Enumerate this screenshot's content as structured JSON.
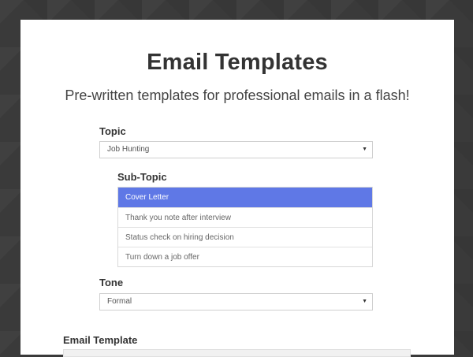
{
  "header": {
    "title": "Email Templates",
    "subtitle": "Pre-written templates for professional emails in a flash!"
  },
  "topic": {
    "label": "Topic",
    "selected": "Job Hunting"
  },
  "subtopic": {
    "label": "Sub-Topic",
    "options": [
      {
        "label": "Cover Letter",
        "selected": true
      },
      {
        "label": "Thank you note after interview",
        "selected": false
      },
      {
        "label": "Status check on hiring decision",
        "selected": false
      },
      {
        "label": "Turn down a job offer",
        "selected": false
      }
    ]
  },
  "tone": {
    "label": "Tone",
    "selected": "Formal"
  },
  "template": {
    "label": "Email Template"
  },
  "icons": {
    "dropdown": "caret-down-icon"
  },
  "colors": {
    "page_background": "#3a3a3a",
    "card_background": "#ffffff",
    "selected_item": "#5f78e6",
    "heading_text": "#333333"
  }
}
